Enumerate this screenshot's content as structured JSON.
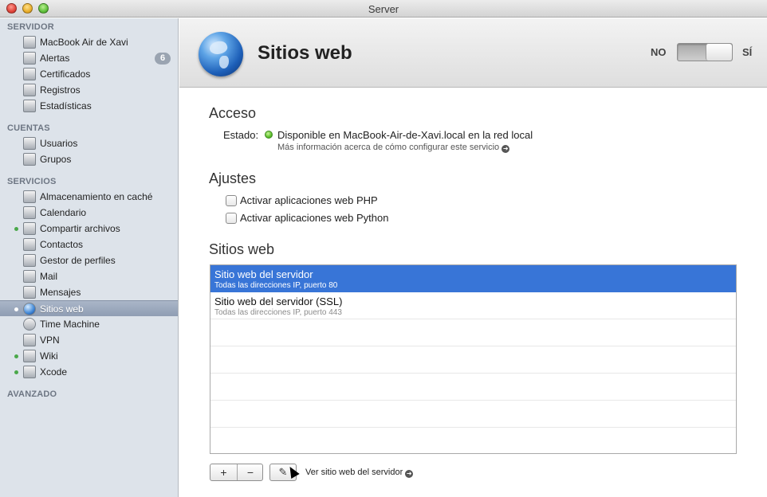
{
  "window": {
    "title": "Server"
  },
  "sidebar": {
    "sections": [
      {
        "title": "SERVIDOR",
        "items": [
          {
            "label": "MacBook Air de Xavi",
            "icon": "laptop-icon"
          },
          {
            "label": "Alertas",
            "icon": "megaphone-icon",
            "badge": "6"
          },
          {
            "label": "Certificados",
            "icon": "certificate-icon"
          },
          {
            "label": "Registros",
            "icon": "log-icon"
          },
          {
            "label": "Estadísticas",
            "icon": "stats-icon"
          }
        ]
      },
      {
        "title": "CUENTAS",
        "items": [
          {
            "label": "Usuarios",
            "icon": "user-icon"
          },
          {
            "label": "Grupos",
            "icon": "group-icon"
          }
        ]
      },
      {
        "title": "SERVICIOS",
        "items": [
          {
            "label": "Almacenamiento en caché",
            "icon": "cache-icon"
          },
          {
            "label": "Calendario",
            "icon": "calendar-icon"
          },
          {
            "label": "Compartir archivos",
            "icon": "file-sharing-icon",
            "active": true
          },
          {
            "label": "Contactos",
            "icon": "contacts-icon"
          },
          {
            "label": "Gestor de perfiles",
            "icon": "profile-manager-icon"
          },
          {
            "label": "Mail",
            "icon": "mail-icon"
          },
          {
            "label": "Mensajes",
            "icon": "messages-icon"
          },
          {
            "label": "Sitios web",
            "icon": "globe-icon",
            "active": true,
            "selected": true
          },
          {
            "label": "Time Machine",
            "icon": "time-machine-icon"
          },
          {
            "label": "VPN",
            "icon": "vpn-icon"
          },
          {
            "label": "Wiki",
            "icon": "wiki-icon",
            "active": true
          },
          {
            "label": "Xcode",
            "icon": "hammer-icon",
            "active": true
          }
        ]
      },
      {
        "title": "AVANZADO",
        "items": []
      }
    ]
  },
  "header": {
    "title": "Sitios web",
    "icon": "globe-icon",
    "switch_off_label": "NO",
    "switch_on_label": "SÍ",
    "switch_state": "on"
  },
  "acceso": {
    "heading": "Acceso",
    "estado_label": "Estado:",
    "estado_value": "Disponible en MacBook-Air-de-Xavi.local en la red local",
    "status_color": "#5cbf2a",
    "info_link": "Más información acerca de cómo configurar este servicio"
  },
  "ajustes": {
    "heading": "Ajustes",
    "checkboxes": [
      {
        "label": "Activar aplicaciones web PHP",
        "checked": false
      },
      {
        "label": "Activar aplicaciones web Python",
        "checked": false
      }
    ]
  },
  "sitios": {
    "heading": "Sitios web",
    "rows": [
      {
        "title": "Sitio web del servidor",
        "subtitle": "Todas las direcciones IP, puerto 80",
        "selected": true
      },
      {
        "title": "Sitio web del servidor (SSL)",
        "subtitle": "Todas las direcciones IP, puerto 443",
        "selected": false
      }
    ],
    "add_label": "+",
    "remove_label": "−",
    "edit_label": "✎",
    "view_link": "Ver sitio web del servidor"
  },
  "colors": {
    "selection": "#3875d7",
    "sidebar_bg": "#dde3ea"
  }
}
